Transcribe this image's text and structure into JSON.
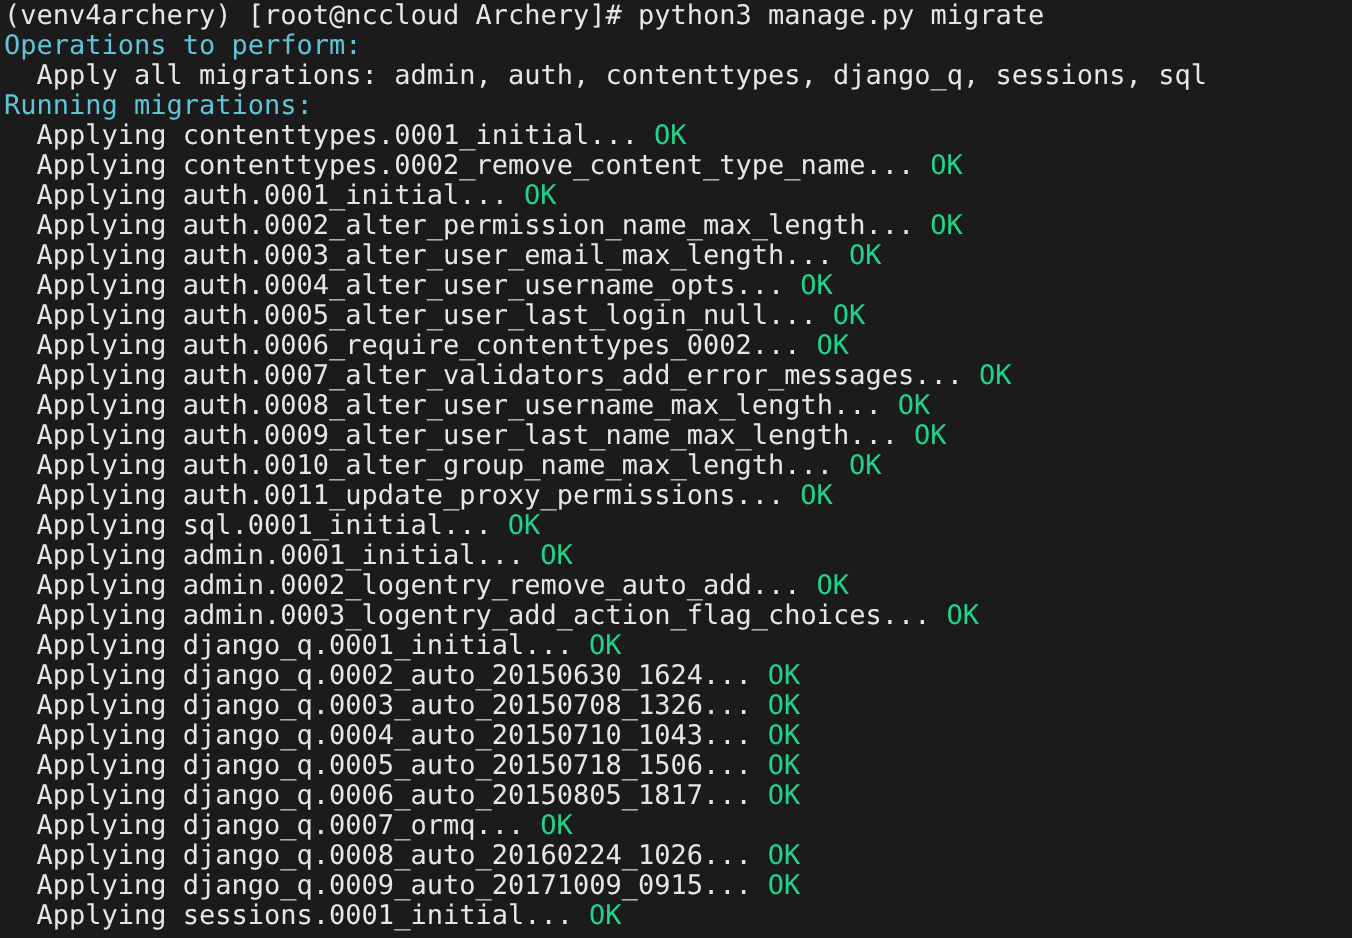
{
  "terminal": {
    "lines": [
      {
        "kind": "command",
        "text": "(venv4archery) [root@nccloud Archery]# python3 manage.py migrate"
      },
      {
        "kind": "heading",
        "text": "Operations to perform:"
      },
      {
        "kind": "plain",
        "text": "  Apply all migrations: admin, auth, contenttypes, django_q, sessions, sql"
      },
      {
        "kind": "heading",
        "text": "Running migrations:"
      },
      {
        "kind": "migration",
        "text": "  Applying contenttypes.0001_initial...",
        "status": "OK"
      },
      {
        "kind": "migration",
        "text": "  Applying contenttypes.0002_remove_content_type_name...",
        "status": "OK"
      },
      {
        "kind": "migration",
        "text": "  Applying auth.0001_initial...",
        "status": "OK"
      },
      {
        "kind": "migration",
        "text": "  Applying auth.0002_alter_permission_name_max_length...",
        "status": "OK"
      },
      {
        "kind": "migration",
        "text": "  Applying auth.0003_alter_user_email_max_length...",
        "status": "OK"
      },
      {
        "kind": "migration",
        "text": "  Applying auth.0004_alter_user_username_opts...",
        "status": "OK"
      },
      {
        "kind": "migration",
        "text": "  Applying auth.0005_alter_user_last_login_null...",
        "status": "OK"
      },
      {
        "kind": "migration",
        "text": "  Applying auth.0006_require_contenttypes_0002...",
        "status": "OK"
      },
      {
        "kind": "migration",
        "text": "  Applying auth.0007_alter_validators_add_error_messages...",
        "status": "OK"
      },
      {
        "kind": "migration",
        "text": "  Applying auth.0008_alter_user_username_max_length...",
        "status": "OK"
      },
      {
        "kind": "migration",
        "text": "  Applying auth.0009_alter_user_last_name_max_length...",
        "status": "OK"
      },
      {
        "kind": "migration",
        "text": "  Applying auth.0010_alter_group_name_max_length...",
        "status": "OK"
      },
      {
        "kind": "migration",
        "text": "  Applying auth.0011_update_proxy_permissions...",
        "status": "OK"
      },
      {
        "kind": "migration",
        "text": "  Applying sql.0001_initial...",
        "status": "OK"
      },
      {
        "kind": "migration",
        "text": "  Applying admin.0001_initial...",
        "status": "OK"
      },
      {
        "kind": "migration",
        "text": "  Applying admin.0002_logentry_remove_auto_add...",
        "status": "OK"
      },
      {
        "kind": "migration",
        "text": "  Applying admin.0003_logentry_add_action_flag_choices...",
        "status": "OK"
      },
      {
        "kind": "migration",
        "text": "  Applying django_q.0001_initial...",
        "status": "OK"
      },
      {
        "kind": "migration",
        "text": "  Applying django_q.0002_auto_20150630_1624...",
        "status": "OK"
      },
      {
        "kind": "migration",
        "text": "  Applying django_q.0003_auto_20150708_1326...",
        "status": "OK"
      },
      {
        "kind": "migration",
        "text": "  Applying django_q.0004_auto_20150710_1043...",
        "status": "OK"
      },
      {
        "kind": "migration",
        "text": "  Applying django_q.0005_auto_20150718_1506...",
        "status": "OK"
      },
      {
        "kind": "migration",
        "text": "  Applying django_q.0006_auto_20150805_1817...",
        "status": "OK"
      },
      {
        "kind": "migration",
        "text": "  Applying django_q.0007_ormq...",
        "status": "OK"
      },
      {
        "kind": "migration",
        "text": "  Applying django_q.0008_auto_20160224_1026...",
        "status": "OK"
      },
      {
        "kind": "migration",
        "text": "  Applying django_q.0009_auto_20171009_0915...",
        "status": "OK"
      },
      {
        "kind": "migration",
        "text": "  Applying sessions.0001_initial...",
        "status": "OK"
      }
    ]
  }
}
